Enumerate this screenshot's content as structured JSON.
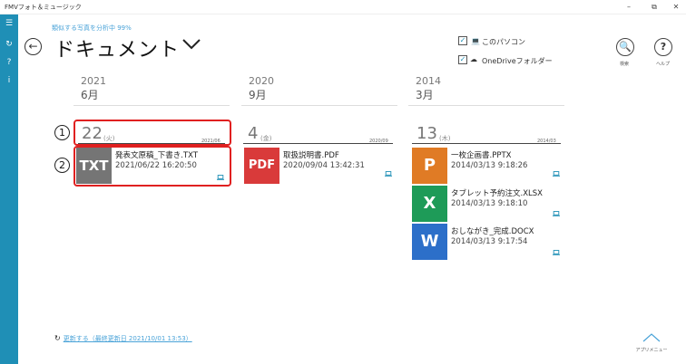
{
  "window": {
    "title": "FMVフォト＆ミュージック",
    "controls": [
      "–",
      "⧉",
      "✕"
    ]
  },
  "sidebar": {
    "items": [
      {
        "icon": "hamburger-menu-icon",
        "glyph": "☰"
      },
      {
        "icon": "refresh-icon",
        "glyph": "↻"
      },
      {
        "icon": "help-icon",
        "glyph": "?"
      },
      {
        "icon": "info-icon",
        "glyph": "i"
      }
    ]
  },
  "status": "類似する写真を分析中 99%",
  "header": {
    "title": "ドキュメント"
  },
  "sources": [
    {
      "label": "このパソコン",
      "checked": true,
      "icon": "laptop-icon"
    },
    {
      "label": "OneDriveフォルダー",
      "checked": true,
      "icon": "cloud-icon"
    }
  ],
  "tools": {
    "search_label": "検索",
    "help_label": "ヘルプ"
  },
  "columns": [
    {
      "year": "2021",
      "month": "6月",
      "day": {
        "num": "22",
        "dow": "(火)",
        "date": "2021/06"
      },
      "files": [
        {
          "type": "TXT",
          "color": "#757575",
          "name": "発表文原稿_下書き.TXT",
          "date": "2021/06/22 16:20:50"
        }
      ]
    },
    {
      "year": "2020",
      "month": "9月",
      "day": {
        "num": "4",
        "dow": "(金)",
        "date": "2020/09"
      },
      "files": [
        {
          "type": "PDF",
          "color": "#d93a3a",
          "name": "取扱説明書.PDF",
          "date": "2020/09/04 13:42:31"
        }
      ]
    },
    {
      "year": "2014",
      "month": "3月",
      "day": {
        "num": "13",
        "dow": "(木)",
        "date": "2014/03"
      },
      "files": [
        {
          "type": "P",
          "color": "#e07b25",
          "name": "一枚企画書.PPTX",
          "date": "2014/03/13 9:18:26"
        },
        {
          "type": "X",
          "color": "#1e9b58",
          "name": "タブレット予約注文.XLSX",
          "date": "2014/03/13 9:18:10"
        },
        {
          "type": "W",
          "color": "#2c6fc9",
          "name": "おしながき_完成.DOCX",
          "date": "2014/03/13 9:17:54"
        }
      ]
    }
  ],
  "annotations": [
    "1",
    "2"
  ],
  "refresh": {
    "text": "更新する（最終更新日 2021/10/01 13:53）"
  },
  "app_menu": {
    "label": "アプリメニュー"
  }
}
